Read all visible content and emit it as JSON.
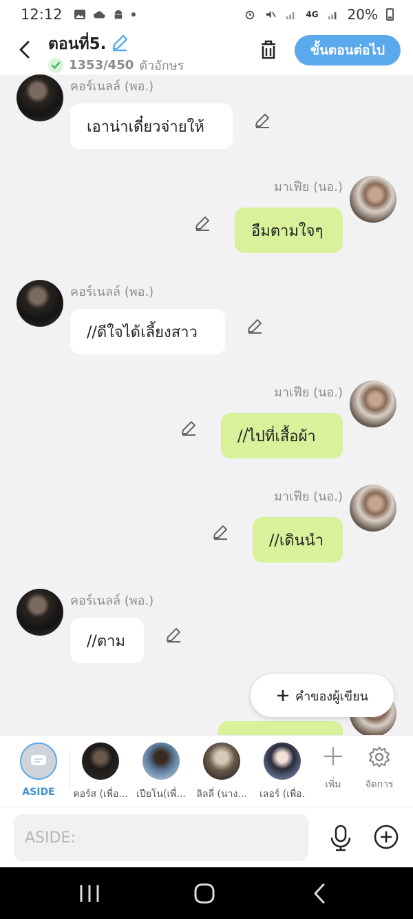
{
  "status_bar": {
    "time": "12:12",
    "network": "4G",
    "battery": "20%"
  },
  "header": {
    "title": "ตอนที่5.",
    "char_count": "1353/450",
    "char_unit": "ตัวอักษร",
    "next_button": "ขั้นตอนต่อไป"
  },
  "messages": [
    {
      "side": "left",
      "sender": "คอร์เนลล์ (พอ.)",
      "text": "เอาน่าเดี๋ยวจ่ายให้"
    },
    {
      "side": "right",
      "sender": "มาเฟีย (นอ.)",
      "text": "อืมตามใจๆ"
    },
    {
      "side": "left",
      "sender": "คอร์เนลล์ (พอ.)",
      "text": "//ดีใจได้เลี้ยงสาว"
    },
    {
      "side": "right",
      "sender": "มาเฟีย (นอ.)",
      "text": "//ไปที่เสื้อผ้า"
    },
    {
      "side": "right",
      "sender": "มาเฟีย (นอ.)",
      "text": "//เดินนำ"
    },
    {
      "side": "left",
      "sender": "คอร์เนลล์ (พอ.)",
      "text": "//ตาม"
    }
  ],
  "author_note_button": "คำของผู้เขียน",
  "characters": [
    {
      "label": "ASIDE"
    },
    {
      "label": "คอร์ส (เพื่อ..."
    },
    {
      "label": "เปียโน(เพื่..."
    },
    {
      "label": "ลิลลี่ (นาง..."
    },
    {
      "label": "เลอร์ (เพื่อ."
    }
  ],
  "tools": {
    "add_label": "เพิ่ม",
    "manage_label": "จัดการ"
  },
  "input": {
    "placeholder": "ASIDE:"
  },
  "colors": {
    "accent": "#5aa9ec",
    "right_bubble": "#d8f19a",
    "left_bubble": "#ffffff",
    "background": "#f2f2f4"
  }
}
